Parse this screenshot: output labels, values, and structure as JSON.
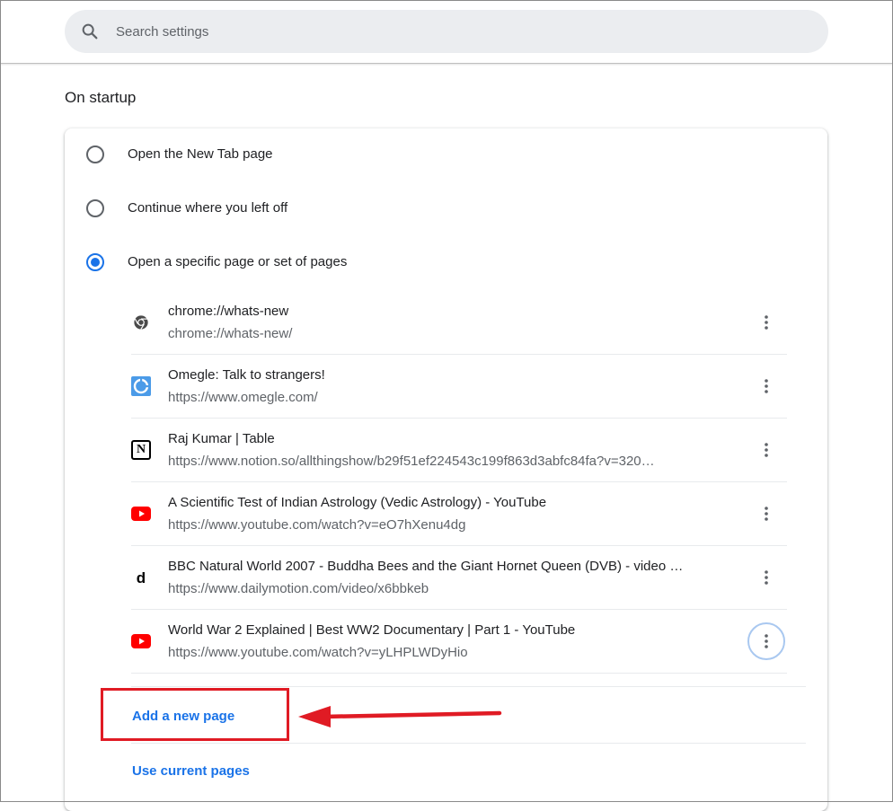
{
  "search": {
    "placeholder": "Search settings"
  },
  "section_title": "On startup",
  "radio_options": [
    {
      "label": "Open the New Tab page",
      "checked": false
    },
    {
      "label": "Continue where you left off",
      "checked": false
    },
    {
      "label": "Open a specific page or set of pages",
      "checked": true
    }
  ],
  "pages": [
    {
      "title": "chrome://whats-new",
      "url": "chrome://whats-new/",
      "icon": "chrome-icon"
    },
    {
      "title": "Omegle: Talk to strangers!",
      "url": "https://www.omegle.com/",
      "icon": "omegle-icon"
    },
    {
      "title": "Raj Kumar | Table",
      "url": "https://www.notion.so/allthingshow/b29f51ef224543c199f863d3abfc84fa?v=320…",
      "icon": "notion-icon",
      "icon_text": "N"
    },
    {
      "title": "A Scientific Test of Indian Astrology (Vedic Astrology) - YouTube",
      "url": "https://www.youtube.com/watch?v=eO7hXenu4dg",
      "icon": "youtube-icon"
    },
    {
      "title": "BBC Natural World 2007 - Buddha Bees and the Giant Hornet Queen (DVB) - video …",
      "url": "https://www.dailymotion.com/video/x6bbkeb",
      "icon": "dailymotion-icon",
      "icon_text": "d"
    },
    {
      "title": "World War 2 Explained | Best WW2 Documentary | Part 1 - YouTube",
      "url": "https://www.youtube.com/watch?v=yLHPLWDyHio",
      "icon": "youtube-icon"
    }
  ],
  "actions": {
    "add_page": "Add a new page",
    "use_current": "Use current pages"
  },
  "colors": {
    "accent": "#1a73e8",
    "annotation": "#e01b24",
    "youtube": "#ff0000"
  }
}
